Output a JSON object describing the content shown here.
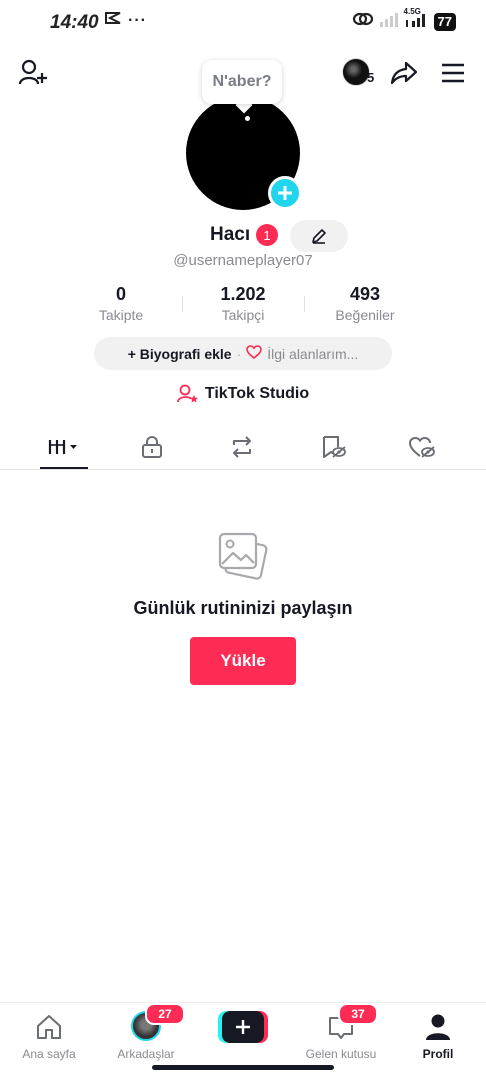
{
  "status_bar": {
    "time": "14:40",
    "left_icons": [
      "capcut-icon",
      "more-dots-icon"
    ],
    "network": "4.5G",
    "battery": "77"
  },
  "top_bar": {
    "story_count": "5"
  },
  "tooltip": {
    "text": "N'aber?"
  },
  "profile": {
    "display_name": "Hacı",
    "name_badge": "1",
    "username": "@usernameplayer07"
  },
  "stats": [
    {
      "value": "0",
      "label": "Takipte"
    },
    {
      "value": "1.202",
      "label": "Takipçi"
    },
    {
      "value": "493",
      "label": "Beğeniler"
    }
  ],
  "bio_bar": {
    "add_bio": "+ Biyografi ekle",
    "separator": "·",
    "interests": "İlgi alanlarım..."
  },
  "studio": {
    "label": "TikTok Studio"
  },
  "empty_state": {
    "title": "Günlük rutininizi paylaşın",
    "button": "Yükle"
  },
  "bottom_nav": {
    "items": [
      {
        "label": "Ana sayfa",
        "active": false
      },
      {
        "label": "Arkadaşlar",
        "badge": "27",
        "active": false
      },
      {
        "label": "",
        "active": false
      },
      {
        "label": "Gelen kutusu",
        "badge": "37",
        "active": false
      },
      {
        "label": "Profil",
        "active": true
      }
    ]
  },
  "colors": {
    "accent": "#fe2c55",
    "cyan": "#20d5ec",
    "text": "#161823",
    "muted": "#8a8b91"
  }
}
